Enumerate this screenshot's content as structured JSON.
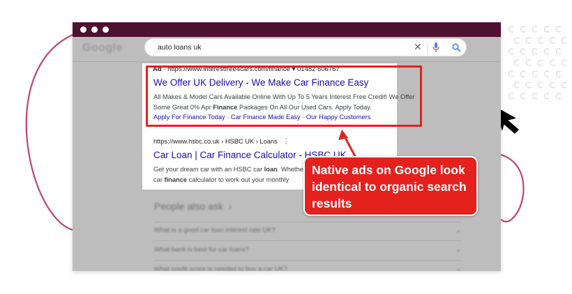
{
  "search": {
    "logo": "Google",
    "query": "auto loans uk",
    "clear_icon": "close-icon",
    "mic_icon": "microphone-icon",
    "search_icon": "search-icon"
  },
  "ad": {
    "ad_label": "Ad",
    "url": " · https://www.interestfree4cars.com/finance ",
    "dropdown": "▾",
    "phone": " 01482 606767",
    "title": "We Offer UK Delivery - We Make Car Finance Easy",
    "desc_part1": "All Makes & Model Cars Available Online With Up To 5 Years Interest Free Credit! We Offer Some Great 0% Apr ",
    "desc_bold": "Finance",
    "desc_part2": " Packages On All Our Used Cars. Apply Today.",
    "sitelinks": "Apply For Finance Today · Car Finance Made Easy · Our Happy Customers"
  },
  "organic": {
    "url": "https://www.hsbc.co.uk › HSBC UK › Loans",
    "menu": "⋮",
    "title": "Car Loan | Car Finance Calculator - HSBC UK",
    "desc_part1": "Get your dream car with an HSBC car ",
    "desc_bold1": "loan",
    "desc_part2": ". Whether ... our car ",
    "desc_bold2": "finance",
    "desc_part3": " calculator to work out your monthly"
  },
  "people_also_ask": {
    "heading": "People also ask",
    "questions": [
      "What is a good car loan interest rate UK?",
      "What bank is best for car loans?",
      "What credit score is needed to buy a car UK?"
    ]
  },
  "callout": {
    "text": "Native ads on Google look identical to organic search results"
  },
  "colors": {
    "titlebar": "#4e1131",
    "highlight": "#e5211d",
    "link": "#1a0dab",
    "deco_curve": "#c2456d"
  }
}
